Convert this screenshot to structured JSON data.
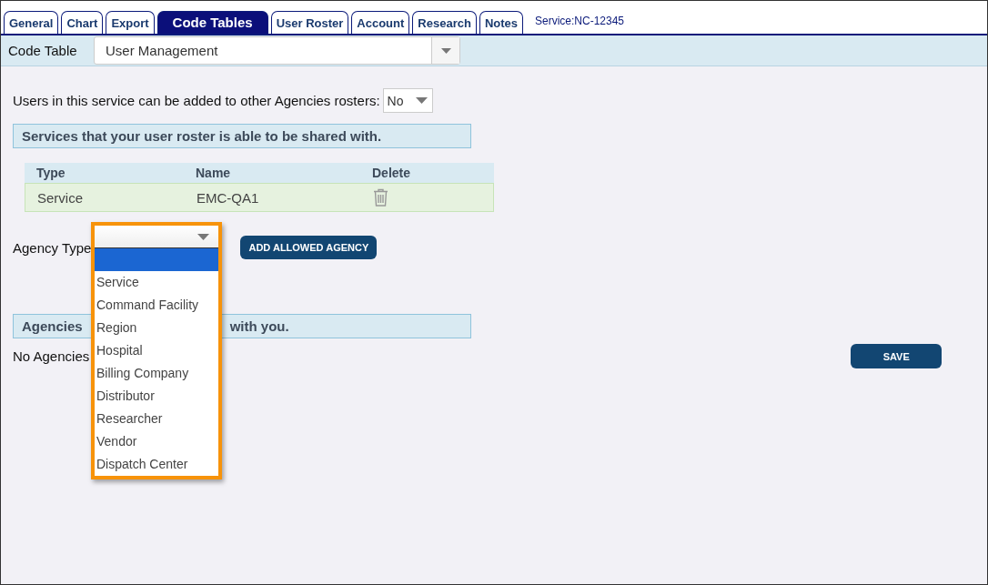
{
  "tabs": [
    {
      "label": "General",
      "selected": false
    },
    {
      "label": "Chart",
      "selected": false
    },
    {
      "label": "Export",
      "selected": false
    },
    {
      "label": "Code Tables",
      "selected": true
    },
    {
      "label": "User Roster",
      "selected": false
    },
    {
      "label": "Account",
      "selected": false
    },
    {
      "label": "Research",
      "selected": false
    },
    {
      "label": "Notes",
      "selected": false
    }
  ],
  "service_label": "Service:NC-12345",
  "code_table": {
    "label": "Code Table",
    "value": "User Management"
  },
  "roster_share": {
    "label": "Users in this service can be added to other Agencies rosters:",
    "value": "No"
  },
  "shared_heading": "Services that your user roster is able to be shared with.",
  "shared_table": {
    "columns": [
      "Type",
      "Name",
      "Delete"
    ],
    "rows": [
      {
        "type": "Service",
        "name": "EMC-QA1"
      }
    ]
  },
  "agency_type": {
    "label": "Agency Type",
    "options": [
      {
        "selected": true
      },
      {
        "label": "Service",
        "selected": false
      },
      {
        "label": "Command Facility",
        "selected": false
      },
      {
        "label": "Region",
        "selected": false
      },
      {
        "label": "Hospital",
        "selected": false
      },
      {
        "label": "Billing Company",
        "selected": false
      },
      {
        "label": "Distributor",
        "selected": false
      },
      {
        "label": "Researcher",
        "selected": false
      },
      {
        "label": "Vendor",
        "selected": false
      },
      {
        "label": "Dispatch Center",
        "selected": false
      }
    ]
  },
  "add_button": "ADD ALLOWED AGENCY",
  "agencies_heading": {
    "left": "Agencies",
    "right": "with you."
  },
  "no_agencies": "No Agencies",
  "save_button": "SAVE"
}
